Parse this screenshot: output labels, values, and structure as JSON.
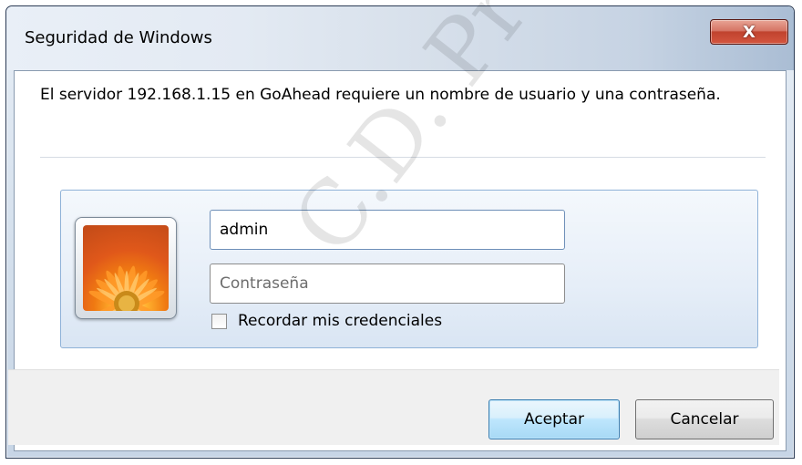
{
  "window": {
    "title": "Seguridad de Windows",
    "close_symbol": "X"
  },
  "message": "El servidor 192.168.1.15 en GoAhead requiere un nombre de usuario y una contraseña.",
  "credentials": {
    "username_value": "admin",
    "password_placeholder": "Contraseña",
    "remember_label": "Recordar mis credenciales",
    "remember_checked": false,
    "user_tile_icon": "flower-icon"
  },
  "buttons": {
    "ok_label": "Aceptar",
    "cancel_label": "Cancelar"
  },
  "watermark": "C.D. Products",
  "colors": {
    "accent": "#3c7fb1",
    "close_button": "#c0432e",
    "panel_border": "#8fb2d8"
  }
}
